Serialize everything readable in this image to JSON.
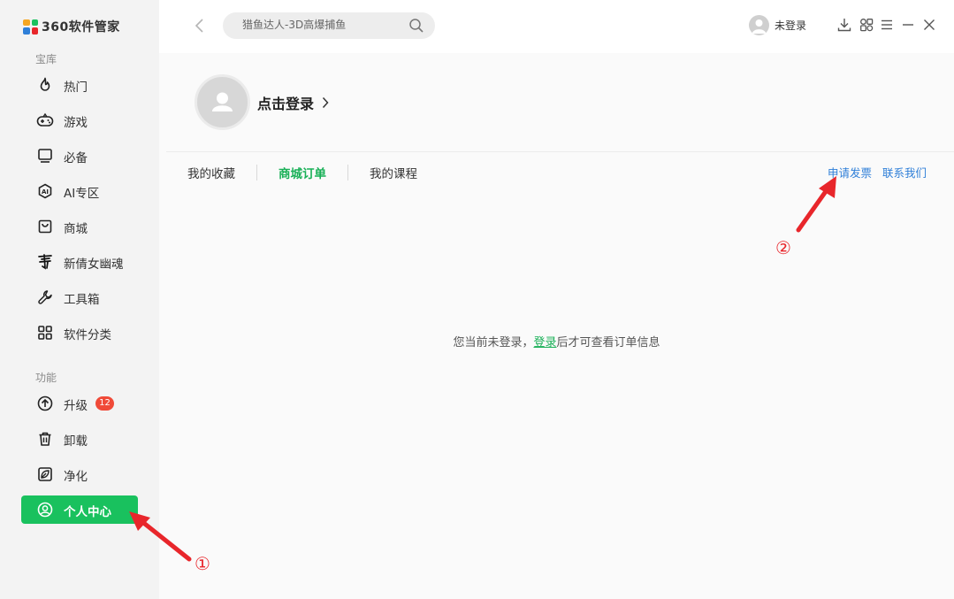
{
  "app": {
    "logo_text": "360软件管家",
    "logo_colors": [
      "#f5a623",
      "#19c15e",
      "#2f7fd8",
      "#e8262b"
    ]
  },
  "sidebar": {
    "section_library": "宝库",
    "section_function": "功能",
    "items": [
      {
        "label": "热门",
        "icon": "fire-icon"
      },
      {
        "label": "游戏",
        "icon": "gamepad-icon"
      },
      {
        "label": "必备",
        "icon": "monitor-icon"
      },
      {
        "label": "AI专区",
        "icon": "ai-icon"
      },
      {
        "label": "商城",
        "icon": "shopping-bag-icon"
      },
      {
        "label": "新倩女幽魂",
        "icon": "game-logo-icon"
      },
      {
        "label": "工具箱",
        "icon": "wrench-icon"
      },
      {
        "label": "软件分类",
        "icon": "grid-icon"
      }
    ],
    "function_items": [
      {
        "label": "升级",
        "icon": "upgrade-icon",
        "badge": "12"
      },
      {
        "label": "卸载",
        "icon": "trash-icon"
      },
      {
        "label": "净化",
        "icon": "leaf-icon"
      },
      {
        "label": "个人中心",
        "icon": "user-circle-icon",
        "active": true
      }
    ],
    "active_color": "#19c15e"
  },
  "header": {
    "search_placeholder": "猎鱼达人-3D高爆捕鱼",
    "user_label": "未登录"
  },
  "profile": {
    "login_label": "点击登录"
  },
  "tabs": [
    {
      "label": "我的收藏",
      "active": false
    },
    {
      "label": "商城订单",
      "active": true
    },
    {
      "label": "我的课程",
      "active": false
    }
  ],
  "links": {
    "invoice": "申请发票",
    "contact": "联系我们"
  },
  "empty_state": {
    "prefix": "您当前未登录，",
    "link": "登录",
    "suffix": "后才可查看订单信息"
  },
  "annotations": {
    "marker_1": "①",
    "marker_2": "②",
    "color": "#e8262b"
  }
}
